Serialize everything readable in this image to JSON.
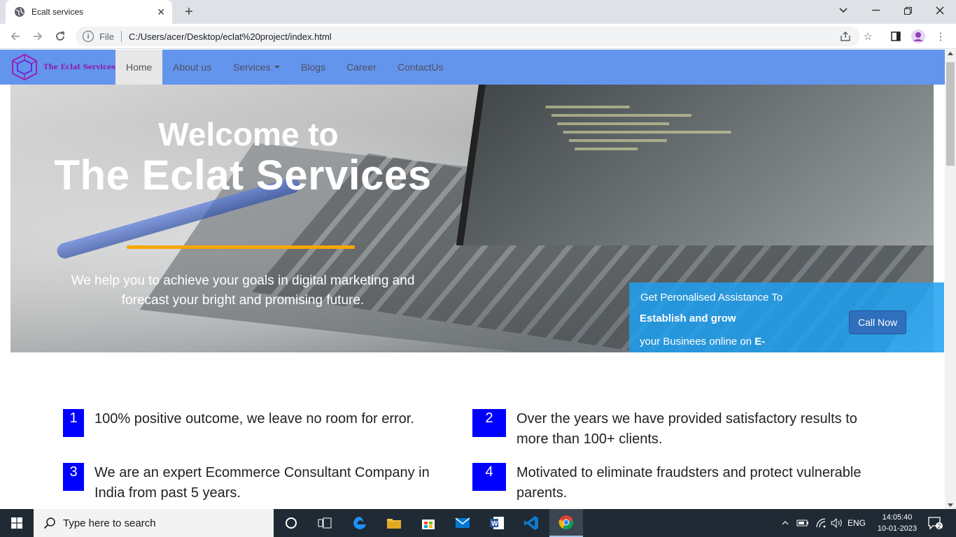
{
  "browser": {
    "tab_title": "Ecalt services",
    "scheme_label": "File",
    "url": "C:/Users/acer/Desktop/eclat%20project/index.html"
  },
  "site": {
    "logo_text": "The Eclat Services",
    "nav": {
      "home": "Home",
      "about": "About us",
      "services": "Services",
      "blogs": "Blogs",
      "career": "Career",
      "contact": "ContactUs"
    },
    "hero": {
      "title_line1": "Welcome to",
      "title_line2": "The Eclat Services",
      "subtitle": "We help you to achieve your goals in digital marketing and forecast your bright and promising future."
    },
    "cta": {
      "line1": "Get Peronalised Assistance To",
      "line2": "Establish and grow",
      "line3_prefix": "your Businees online on",
      "line3_bold": "E-",
      "button": "Call Now"
    },
    "features": [
      {
        "num": "1",
        "text": "100% positive outcome, we leave no room for error."
      },
      {
        "num": "2",
        "text": "Over the years we have provided satisfactory results to more than 100+ clients."
      },
      {
        "num": "3",
        "text": "We are an expert Ecommerce Consultant Company in India from past 5 years."
      },
      {
        "num": "4",
        "text": "Motivated to eliminate fraudsters and protect vulnerable parents."
      }
    ]
  },
  "taskbar": {
    "search_placeholder": "Type here to search",
    "language": "ENG",
    "time": "14:05:40",
    "date": "10-01-2023",
    "notification_count": "2"
  },
  "colors": {
    "nav_bg": "#6495ed",
    "cta_bg": "#1ea0f0",
    "accent_underline": "#f5a700",
    "feature_number_bg": "#0000ff"
  }
}
